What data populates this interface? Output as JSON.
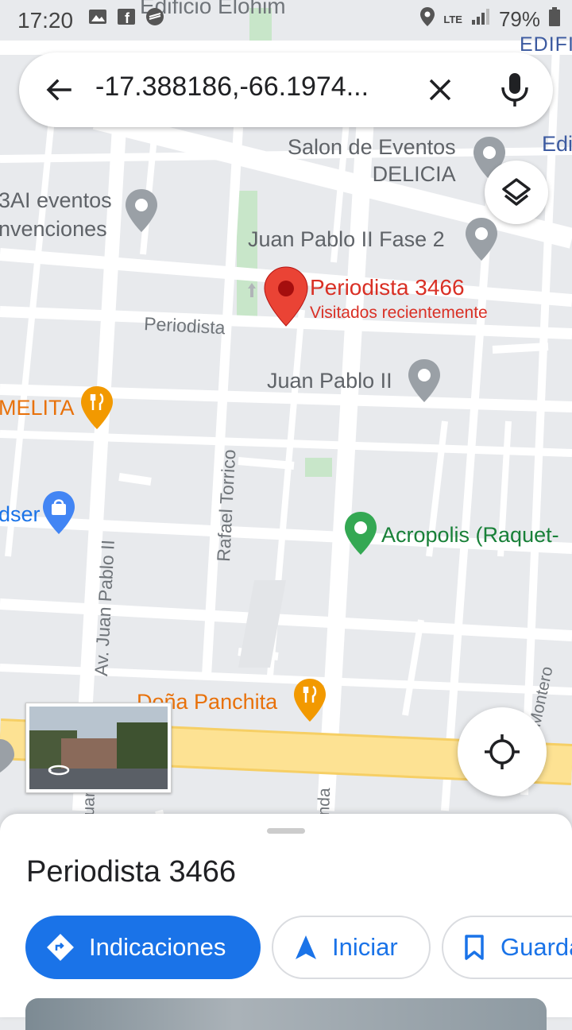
{
  "status_bar": {
    "time": "17:20",
    "network": "LTE",
    "battery": "79%"
  },
  "search": {
    "query": "-17.388186,-66.1974..."
  },
  "map": {
    "top_partial_label": "Edificio Elohim",
    "top_right_label": "EDIFI",
    "edi_label": "Edi",
    "places": [
      {
        "key": "salon",
        "lines": [
          "Salon de Eventos",
          "DELICIA"
        ]
      },
      {
        "key": "bai",
        "lines": [
          "3AI eventos",
          "nvenciones"
        ]
      },
      {
        "key": "jp2fase2",
        "lines": [
          "Juan Pablo II Fase 2"
        ]
      },
      {
        "key": "jp2",
        "lines": [
          "Juan Pablo II"
        ]
      },
      {
        "key": "amelita",
        "lines": [
          "MELITA"
        ]
      },
      {
        "key": "dser",
        "lines": [
          "dser"
        ]
      },
      {
        "key": "acropolis",
        "lines": [
          "Acropolis (Raquet-"
        ]
      },
      {
        "key": "panchita",
        "lines": [
          "Doña Panchita"
        ]
      }
    ],
    "streets": {
      "periodista": "Periodista",
      "rafael_torrico": "Rafael Torrico",
      "av_juan_pablo": "Av. Juan Pablo II",
      "montero": "Montero",
      "bottom_left": "uan",
      "bottom_mid": "nda"
    },
    "selected_pin": {
      "title": "Periodista 3466",
      "subtitle": "Visitados recientemente"
    },
    "colors": {
      "pin_red": "#ea4335",
      "poi_gray": "#70757a",
      "food_orange": "#e8710a",
      "park_green": "#34a853",
      "shop_blue": "#4285f4",
      "road_yellow": "#fde293"
    }
  },
  "sheet": {
    "title": "Periodista 3466",
    "buttons": {
      "directions": "Indicaciones",
      "start": "Iniciar",
      "save": "Guardar"
    },
    "colors": {
      "accent": "#1a73e8"
    }
  }
}
